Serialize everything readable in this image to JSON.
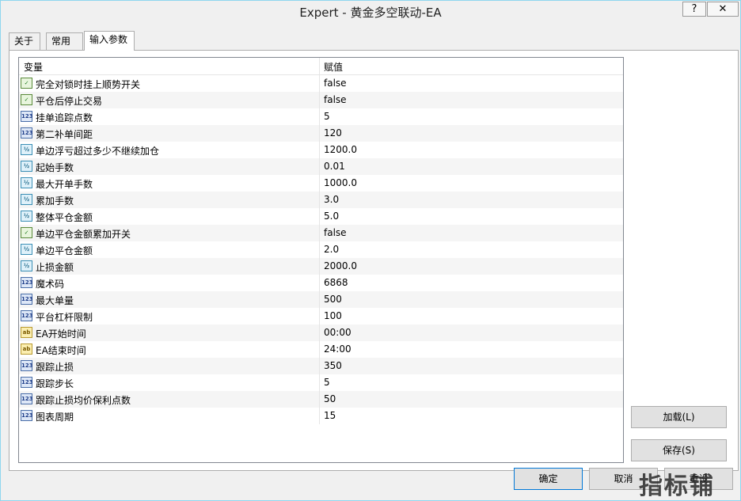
{
  "window": {
    "title": "Expert - 黄金多空联动-EA",
    "help_label": "?",
    "close_label": "✕"
  },
  "tabs": [
    {
      "label": "关于"
    },
    {
      "label": "常用"
    },
    {
      "label": "输入参数"
    }
  ],
  "grid": {
    "col_variable": "变量",
    "col_value": "赋值",
    "rows": [
      {
        "type": "bool",
        "icon": "✓",
        "name": "完全对锁时挂上顺势开关",
        "value": "false"
      },
      {
        "type": "bool",
        "icon": "✓",
        "name": "平仓后停止交易",
        "value": "false"
      },
      {
        "type": "int",
        "icon": "123",
        "name": "挂单追踪点数",
        "value": "5"
      },
      {
        "type": "int",
        "icon": "123",
        "name": "第二补单间距",
        "value": "120"
      },
      {
        "type": "dbl",
        "icon": "½",
        "name": "单边浮亏超过多少不继续加仓",
        "value": "1200.0"
      },
      {
        "type": "dbl",
        "icon": "½",
        "name": "起始手数",
        "value": "0.01"
      },
      {
        "type": "dbl",
        "icon": "½",
        "name": "最大开单手数",
        "value": "1000.0"
      },
      {
        "type": "dbl",
        "icon": "½",
        "name": "累加手数",
        "value": "3.0"
      },
      {
        "type": "dbl",
        "icon": "½",
        "name": "整体平仓金额",
        "value": "5.0"
      },
      {
        "type": "bool",
        "icon": "✓",
        "name": "单边平仓金额累加开关",
        "value": "false"
      },
      {
        "type": "dbl",
        "icon": "½",
        "name": "单边平仓金额",
        "value": "2.0"
      },
      {
        "type": "dbl",
        "icon": "½",
        "name": "止损金额",
        "value": "2000.0"
      },
      {
        "type": "int",
        "icon": "123",
        "name": "魔术码",
        "value": "6868"
      },
      {
        "type": "int",
        "icon": "123",
        "name": "最大单量",
        "value": "500"
      },
      {
        "type": "int",
        "icon": "123",
        "name": "平台杠杆限制",
        "value": "100"
      },
      {
        "type": "str",
        "icon": "ab",
        "name": "EA开始时间",
        "value": "00:00"
      },
      {
        "type": "str",
        "icon": "ab",
        "name": "EA结束时间",
        "value": "24:00"
      },
      {
        "type": "int",
        "icon": "123",
        "name": "跟踪止损",
        "value": "350"
      },
      {
        "type": "int",
        "icon": "123",
        "name": "跟踪步长",
        "value": "5"
      },
      {
        "type": "int",
        "icon": "123",
        "name": "跟踪止损均价保利点数",
        "value": "50"
      },
      {
        "type": "int",
        "icon": "123",
        "name": "图表周期",
        "value": "15"
      }
    ]
  },
  "buttons": {
    "load": "加载(L)",
    "save": "保存(S)",
    "ok": "确定",
    "cancel": "取消",
    "reset": "重设"
  },
  "watermark": "指标铺"
}
